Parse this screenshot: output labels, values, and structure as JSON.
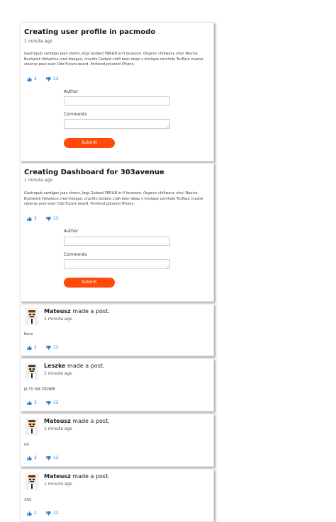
{
  "articles": [
    {
      "title": "Creating user profile in pacmodo",
      "time": "1 minute ago",
      "body": "Gastropub cardigan jean shorts, kogi Godard PBR&B lo-fi locavore. Organic chillwave vinyl Neutra. Bushwick Helvetica cred freegan, crucifix Godard craft beer deep v mixtape cornhole Truffaut master cleanse pour-over Odd Future beard. Portland polaroid iPhone.",
      "likes": "2",
      "dislikes": "12",
      "author_label": "Author",
      "comments_label": "Comments",
      "submit_label": "Submit"
    },
    {
      "title": "Creating Dashboard for 303avenue",
      "time": "1 minute ago",
      "body": "Gastropub cardigan jean shorts, kogi Godard PBR&B lo-fi locavore. Organic chillwave vinyl Neutra. Bushwick Helvetica cred freegan, crucifix Godard craft beer deep v mixtape cornhole Truffaut master cleanse pour-over Odd Future beard. Portland polaroid iPhone.",
      "likes": "2",
      "dislikes": "12",
      "author_label": "Author",
      "comments_label": "Comments",
      "submit_label": "Submit"
    }
  ],
  "posts": [
    {
      "author": "Mateusz",
      "action": " made a post.",
      "time": "1 minute ago",
      "text": "Kono",
      "likes": "2",
      "dislikes": "12"
    },
    {
      "author": "Leszke",
      "action": " made a post.",
      "time": "1 minute ago",
      "text": "JA TO NIE ZROBIE",
      "likes": "2",
      "dislikes": "12"
    },
    {
      "author": "Mateusz",
      "action": " made a post.",
      "time": "1 minute ago",
      "text": "GU",
      "likes": "2",
      "dislikes": "12"
    },
    {
      "author": "Mateusz",
      "action": " made a post.",
      "time": "1 minute ago",
      "text": "XAS",
      "likes": "2",
      "dislikes": "12"
    }
  ],
  "colors": {
    "accent": "#ff4a0a",
    "reaction": "#2a7fd4"
  },
  "icons": {
    "like": "thumbs-up-icon",
    "dislike": "thumbs-down-icon",
    "avatar": "avatar-icon"
  }
}
